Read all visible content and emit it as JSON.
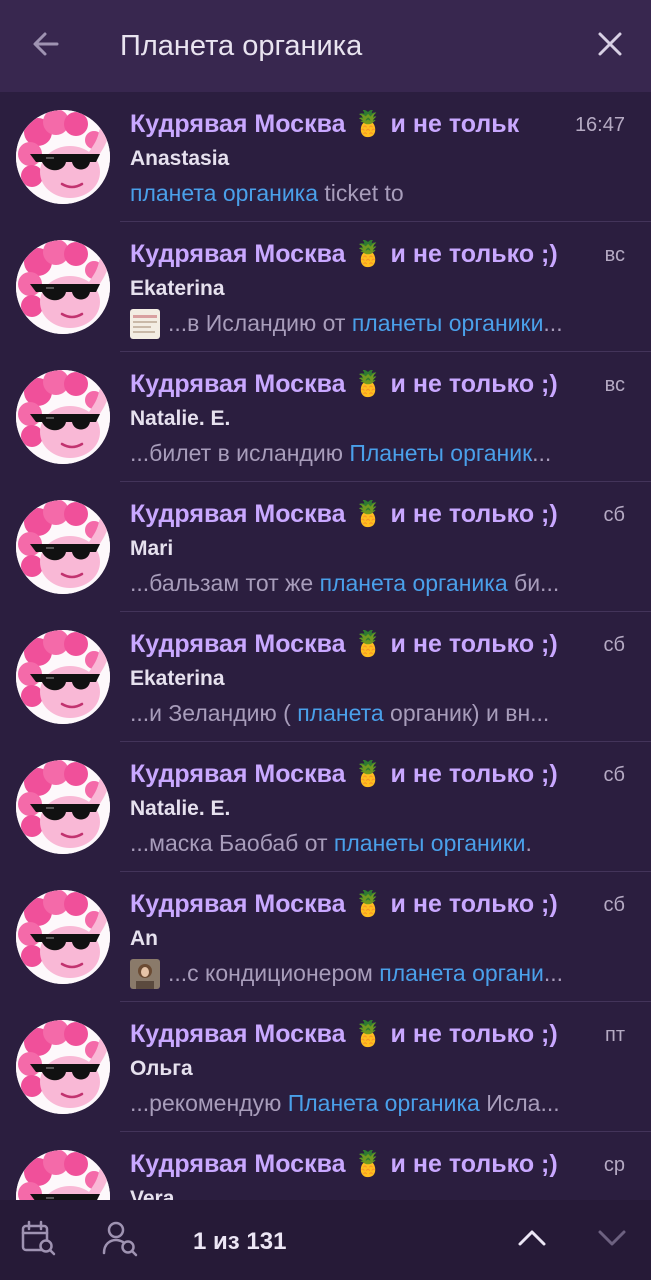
{
  "search": {
    "value": "Планета органика"
  },
  "colors": {
    "accent_title": "#c9a8ff",
    "highlight": "#4aa0ea",
    "background": "#2b1e3f",
    "topbar": "#38274f"
  },
  "icons": {
    "back": "arrow-left-icon",
    "clear": "close-icon",
    "calendar": "calendar-search-icon",
    "user": "user-search-icon",
    "up": "chevron-up-icon",
    "down": "chevron-down-icon"
  },
  "results": [
    {
      "chat": "Кудрявая Москва 🍍 и не тольк",
      "time": "16:47",
      "sender": "Anastasia",
      "thumb": "",
      "snippet": [
        {
          "t": "планета органика",
          "hl": true
        },
        {
          "t": " ticket to",
          "hl": false
        }
      ]
    },
    {
      "chat": "Кудрявая Москва 🍍 и не только ;)",
      "time": "вс",
      "sender": "Ekaterina",
      "thumb": "document",
      "snippet": [
        {
          "t": "...в Исландию от ",
          "hl": false
        },
        {
          "t": "планеты органики",
          "hl": true
        },
        {
          "t": "...",
          "hl": false
        }
      ]
    },
    {
      "chat": "Кудрявая Москва 🍍 и не только ;)",
      "time": "вс",
      "sender": "Natalie. E.",
      "thumb": "",
      "snippet": [
        {
          "t": "...билет в исландию ",
          "hl": false
        },
        {
          "t": "Планеты органик",
          "hl": true
        },
        {
          "t": "...",
          "hl": false
        }
      ]
    },
    {
      "chat": "Кудрявая Москва 🍍 и не только ;)",
      "time": "сб",
      "sender": "Mari",
      "thumb": "",
      "snippet": [
        {
          "t": "...бальзам тот же ",
          "hl": false
        },
        {
          "t": "планета органика",
          "hl": true
        },
        {
          "t": " би...",
          "hl": false
        }
      ]
    },
    {
      "chat": "Кудрявая Москва 🍍 и не только ;)",
      "time": "сб",
      "sender": "Ekaterina",
      "thumb": "",
      "snippet": [
        {
          "t": "...и Зеландию ( ",
          "hl": false
        },
        {
          "t": "планета",
          "hl": true
        },
        {
          "t": " органик) и вн...",
          "hl": false
        }
      ]
    },
    {
      "chat": "Кудрявая Москва 🍍 и не только ;)",
      "time": "сб",
      "sender": "Natalie. E.",
      "thumb": "",
      "snippet": [
        {
          "t": "...маска Баобаб от ",
          "hl": false
        },
        {
          "t": "планеты органики",
          "hl": true
        },
        {
          "t": ".",
          "hl": false
        }
      ]
    },
    {
      "chat": "Кудрявая Москва 🍍 и не только ;)",
      "time": "сб",
      "sender": "An",
      "thumb": "photo",
      "snippet": [
        {
          "t": "...с кондиционером ",
          "hl": false
        },
        {
          "t": "планета органи",
          "hl": true
        },
        {
          "t": "...",
          "hl": false
        }
      ]
    },
    {
      "chat": "Кудрявая Москва 🍍 и не только ;)",
      "time": "пт",
      "sender": "Ольга",
      "thumb": "",
      "snippet": [
        {
          "t": "...рекомендую ",
          "hl": false
        },
        {
          "t": "Планета органика",
          "hl": true
        },
        {
          "t": " Исла...",
          "hl": false
        }
      ]
    },
    {
      "chat": "Кудрявая Москва 🍍 и не только ;)",
      "time": "ср",
      "sender": "Vera",
      "thumb": "",
      "snippet": []
    }
  ],
  "footer": {
    "counter": "1 из 131"
  }
}
